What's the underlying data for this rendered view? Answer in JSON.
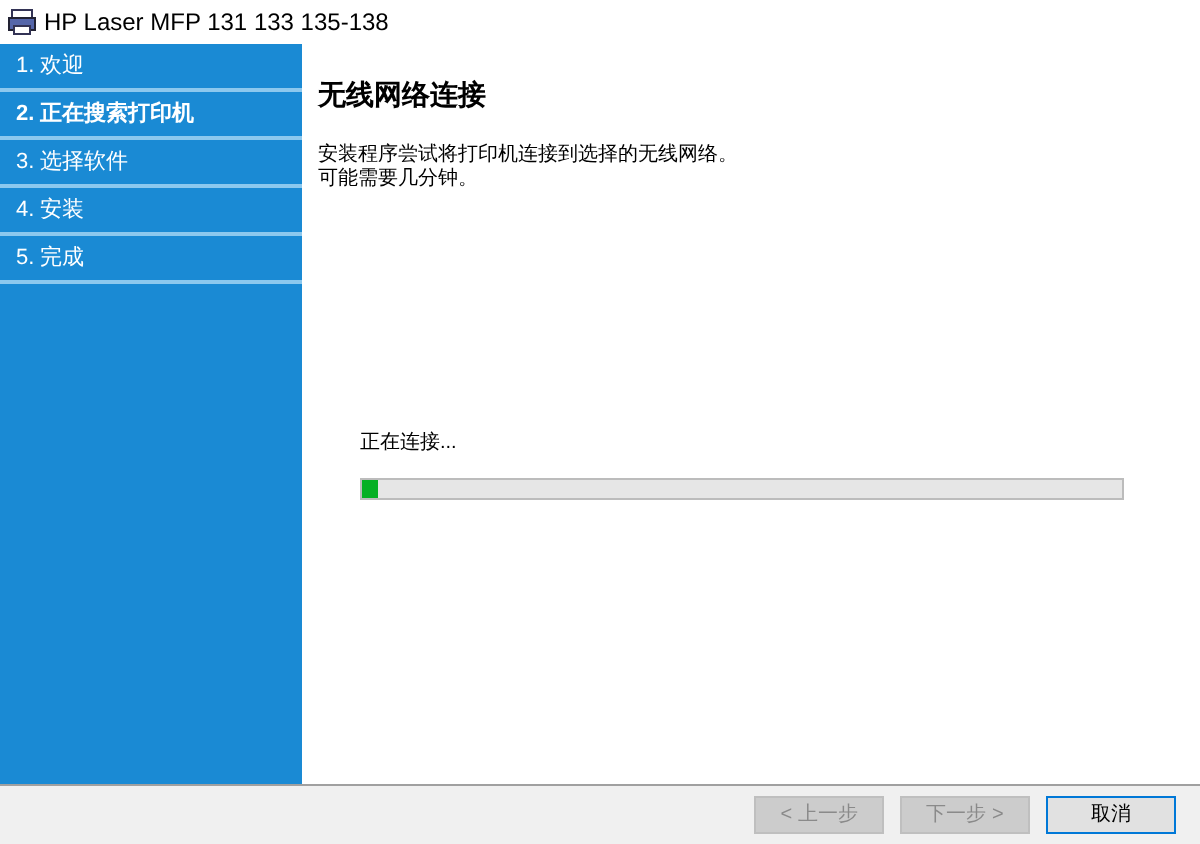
{
  "window": {
    "title": "HP Laser MFP 131 133 135-138"
  },
  "steps": [
    {
      "label": "1. 欢迎",
      "selected": false
    },
    {
      "label": "2. 正在搜索打印机",
      "selected": true
    },
    {
      "label": "3. 选择软件",
      "selected": false
    },
    {
      "label": "4. 安装",
      "selected": false
    },
    {
      "label": "5. 完成",
      "selected": false
    }
  ],
  "page": {
    "heading": "无线网络连接",
    "description": [
      "安装程序尝试将打印机连接到选择的无线网络。",
      "可能需要几分钟。"
    ],
    "status": "正在连接...",
    "progress": {
      "level": 0.02
    }
  },
  "buttons": [
    {
      "label": "< 上一步",
      "disabled": true
    },
    {
      "label": "下一步 >",
      "disabled": true
    },
    {
      "label": "取消",
      "disabled": false
    }
  ]
}
